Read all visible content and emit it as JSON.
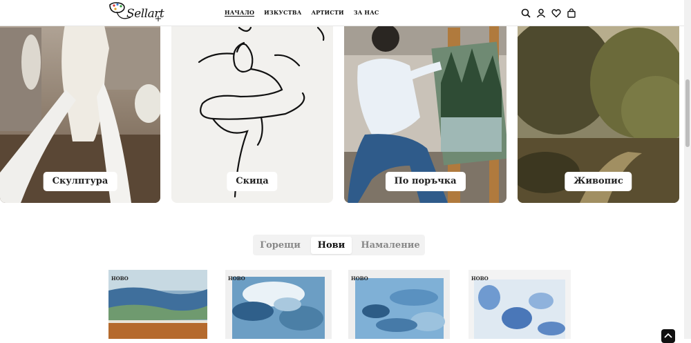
{
  "brand": {
    "logo_text": "Sellart"
  },
  "nav": {
    "items": [
      "НАЧАЛО",
      "ИЗКУСТВА",
      "АРТИСТИ",
      "ЗА НАС"
    ],
    "active": "НАЧАЛО"
  },
  "header_icons": [
    "search-icon",
    "user-icon",
    "heart-icon",
    "bag-icon"
  ],
  "categories": [
    {
      "label": "Скулптура"
    },
    {
      "label": "Скица"
    },
    {
      "label": "По поръчка"
    },
    {
      "label": "Живопис"
    }
  ],
  "tabs": {
    "items": [
      "Горещи",
      "Нови",
      "Намаление"
    ],
    "active": "Нови"
  },
  "products": [
    {
      "badge": "НОВО"
    },
    {
      "badge": "НОВО"
    },
    {
      "badge": "НОВО"
    },
    {
      "badge": "НОВО"
    }
  ],
  "colors": {
    "tab_bg": "#f2f2f2",
    "text": "#111111",
    "muted": "#888888"
  }
}
